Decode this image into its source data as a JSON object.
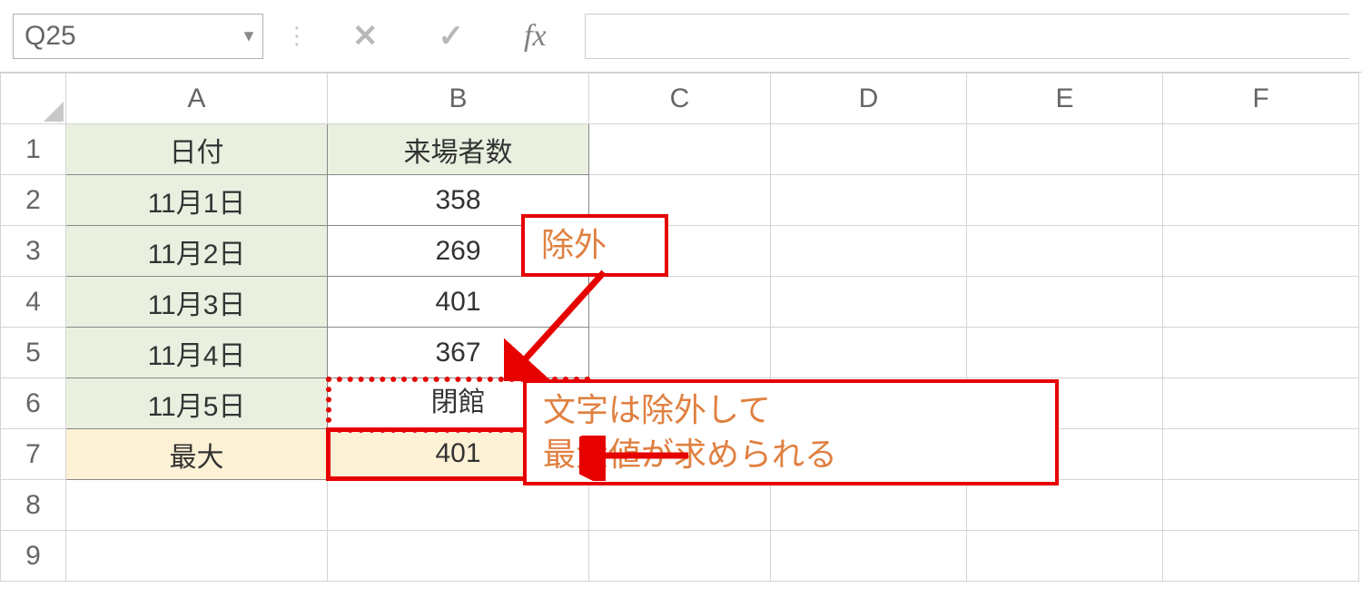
{
  "name_box": {
    "value": "Q25"
  },
  "formula_bar": {
    "cancel": "✕",
    "enter": "✓",
    "fx": "fx",
    "value": ""
  },
  "columns": [
    "A",
    "B",
    "C",
    "D",
    "E",
    "F"
  ],
  "rows": [
    "1",
    "2",
    "3",
    "4",
    "5",
    "6",
    "7",
    "8",
    "9"
  ],
  "table": {
    "header": {
      "a": "日付",
      "b": "来場者数"
    },
    "r2": {
      "a": "11月1日",
      "b": "358"
    },
    "r3": {
      "a": "11月2日",
      "b": "269"
    },
    "r4": {
      "a": "11月3日",
      "b": "401"
    },
    "r5": {
      "a": "11月4日",
      "b": "367"
    },
    "r6": {
      "a": "11月5日",
      "b": "閉館"
    },
    "r7": {
      "a": "最大",
      "b": "401"
    }
  },
  "callouts": {
    "exclude": "除外",
    "explain_l1": "文字は除外して",
    "explain_l2": "最大値が求められる"
  }
}
